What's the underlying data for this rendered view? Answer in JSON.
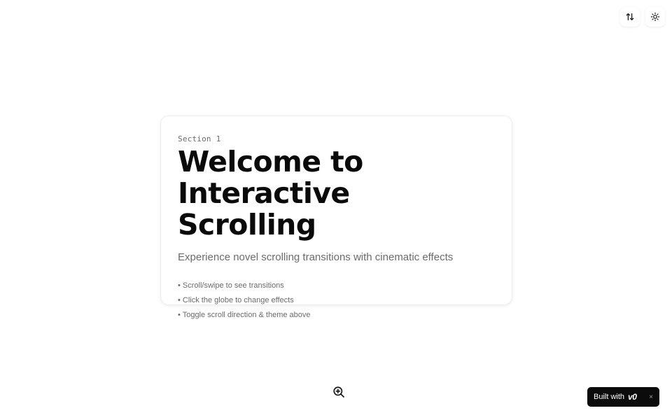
{
  "controls": {
    "scroll_direction_icon": "arrows-up-down-icon",
    "theme_icon": "sun-icon"
  },
  "card": {
    "section_label": "Section 1",
    "headline_line1": "Welcome to",
    "headline_line2": "Interactive Scrolling",
    "subtitle": "Experience novel scrolling transitions with cinematic effects",
    "bullets": [
      "• Scroll/swipe to see transitions",
      "• Click the globe to change effects",
      "• Toggle scroll direction & theme above"
    ]
  },
  "zoom": {
    "icon": "zoom-in-icon"
  },
  "badge": {
    "label": "Built with",
    "logo": "v0",
    "close": "×"
  },
  "colors": {
    "background": "#ffffff",
    "heading": "#0a0a0a",
    "muted": "#6b6b6b",
    "badge_bg": "#0b0b0b"
  }
}
